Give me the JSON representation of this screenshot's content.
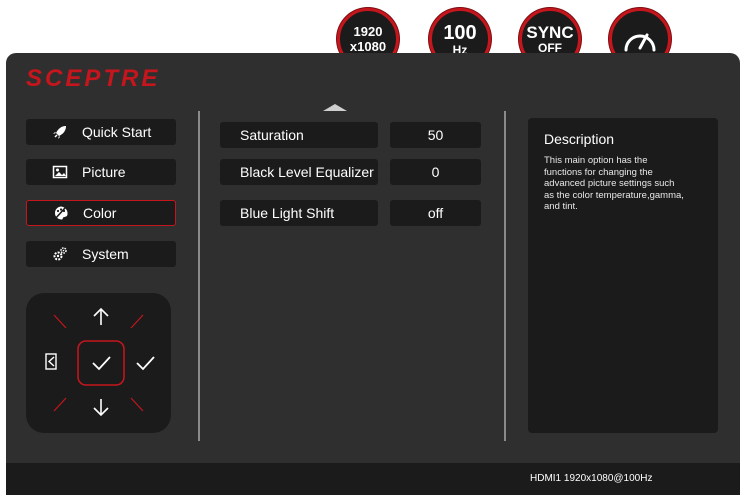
{
  "badges": {
    "resolution": {
      "line1": "1920",
      "line2": "x1080"
    },
    "refresh": {
      "line1": "100",
      "line2": "Hz"
    },
    "sync": {
      "line1": "SYNC",
      "line2": "OFF"
    },
    "gauge_icon": "speedometer-icon"
  },
  "brand": "SCEPTRE",
  "menu": [
    {
      "label": "Quick Start",
      "icon": "rocket-icon",
      "active": false
    },
    {
      "label": "Picture",
      "icon": "picture-icon",
      "active": false
    },
    {
      "label": "Color",
      "icon": "palette-icon",
      "active": true
    },
    {
      "label": "System",
      "icon": "gears-icon",
      "active": false
    }
  ],
  "navpad": {
    "icons": [
      "arrow-up-icon",
      "arrow-down-icon",
      "exit-icon",
      "check-icon",
      "check-right-icon"
    ]
  },
  "settings": [
    {
      "name": "Saturation",
      "value": "50"
    },
    {
      "name": "Black Level Equalizer",
      "value": "0"
    },
    {
      "name": "Blue Light Shift",
      "value": "off"
    }
  ],
  "description": {
    "title": "Description",
    "text": "This main option has the functions for changing the advanced picture settings such as the color temperature,gamma, and tint."
  },
  "status": "HDMI1 1920x1080@100Hz",
  "colors": {
    "accent": "#c4161c",
    "panel": "#2f2f2f",
    "box": "#1b1b1b"
  }
}
